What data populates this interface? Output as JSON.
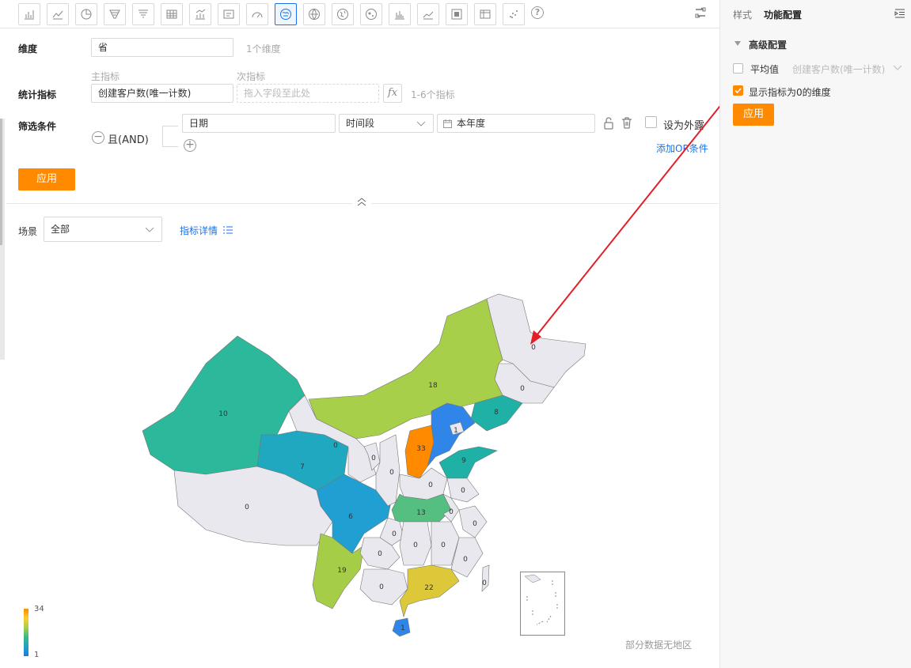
{
  "toolbar": {
    "icons": [
      "bar-chart-icon",
      "line-chart-icon",
      "pie-chart-icon",
      "funnel-icon",
      "funnel-alt-icon",
      "table-icon",
      "combo-chart-icon",
      "kpi-card-icon",
      "gauge-icon",
      "china-map-icon",
      "world-map-icon",
      "globe-map-icon",
      "bubble-map-icon",
      "histogram-icon",
      "area-chart-icon",
      "qr-grid-icon",
      "pivot-table-icon",
      "scatter-icon"
    ],
    "help": "?"
  },
  "dimension": {
    "label": "维度",
    "value": "省",
    "hint": "1个维度"
  },
  "metrics": {
    "label": "统计指标",
    "primary_title": "主指标",
    "secondary_title": "次指标",
    "primary_value": "创建客户数(唯一计数)",
    "secondary_placeholder": "拖入字段至此处",
    "fx": "fx",
    "hint": "1-6个指标"
  },
  "filter": {
    "label": "筛选条件",
    "logic": "且(AND)",
    "field": "日期",
    "operator": "时间段",
    "value": "本年度",
    "expose_label": "设为外露",
    "add_or": "添加OR条件"
  },
  "apply_label": "应用",
  "scene": {
    "label": "场景",
    "value": "全部",
    "detail_link": "指标详情"
  },
  "map": {
    "values": [
      {
        "province": "黑龙江",
        "value": 0
      },
      {
        "province": "吉林",
        "value": 0
      },
      {
        "province": "辽宁",
        "value": 8
      },
      {
        "province": "内蒙古",
        "value": 18
      },
      {
        "province": "新疆",
        "value": 10
      },
      {
        "province": "青海",
        "value": 7
      },
      {
        "province": "西藏",
        "value": 0
      },
      {
        "province": "四川",
        "value": 6
      },
      {
        "province": "云南",
        "value": 19
      },
      {
        "province": "山西",
        "value": 33
      },
      {
        "province": "河北",
        "value": 1
      },
      {
        "province": "山东",
        "value": 9
      },
      {
        "province": "河南",
        "value": 0
      },
      {
        "province": "湖北",
        "value": 13
      },
      {
        "province": "广东",
        "value": 22
      },
      {
        "province": "海南",
        "value": 1
      },
      {
        "province": "甘肃",
        "value": 0
      },
      {
        "province": "宁夏",
        "value": 0
      },
      {
        "province": "陕西",
        "value": 0
      },
      {
        "province": "重庆",
        "value": 0
      },
      {
        "province": "贵州",
        "value": 0
      },
      {
        "province": "广西",
        "value": 0
      },
      {
        "province": "湖南",
        "value": 0
      },
      {
        "province": "江西",
        "value": 0
      },
      {
        "province": "福建",
        "value": 0
      },
      {
        "province": "浙江",
        "value": 0
      },
      {
        "province": "安徽",
        "value": 0
      },
      {
        "province": "江苏",
        "value": 0
      },
      {
        "province": "台湾",
        "value": 0
      }
    ],
    "legend_max": "34",
    "legend_min": "1",
    "no_data_note": "部分数据无地区"
  },
  "panel": {
    "tab_style": "样式",
    "tab_config": "功能配置",
    "section": "高级配置",
    "average_label": "平均值",
    "average_metric": "创建客户数(唯一计数)",
    "show_zero_label": "显示指标为0的维度",
    "show_zero_checked": true,
    "apply_label": "应用"
  }
}
